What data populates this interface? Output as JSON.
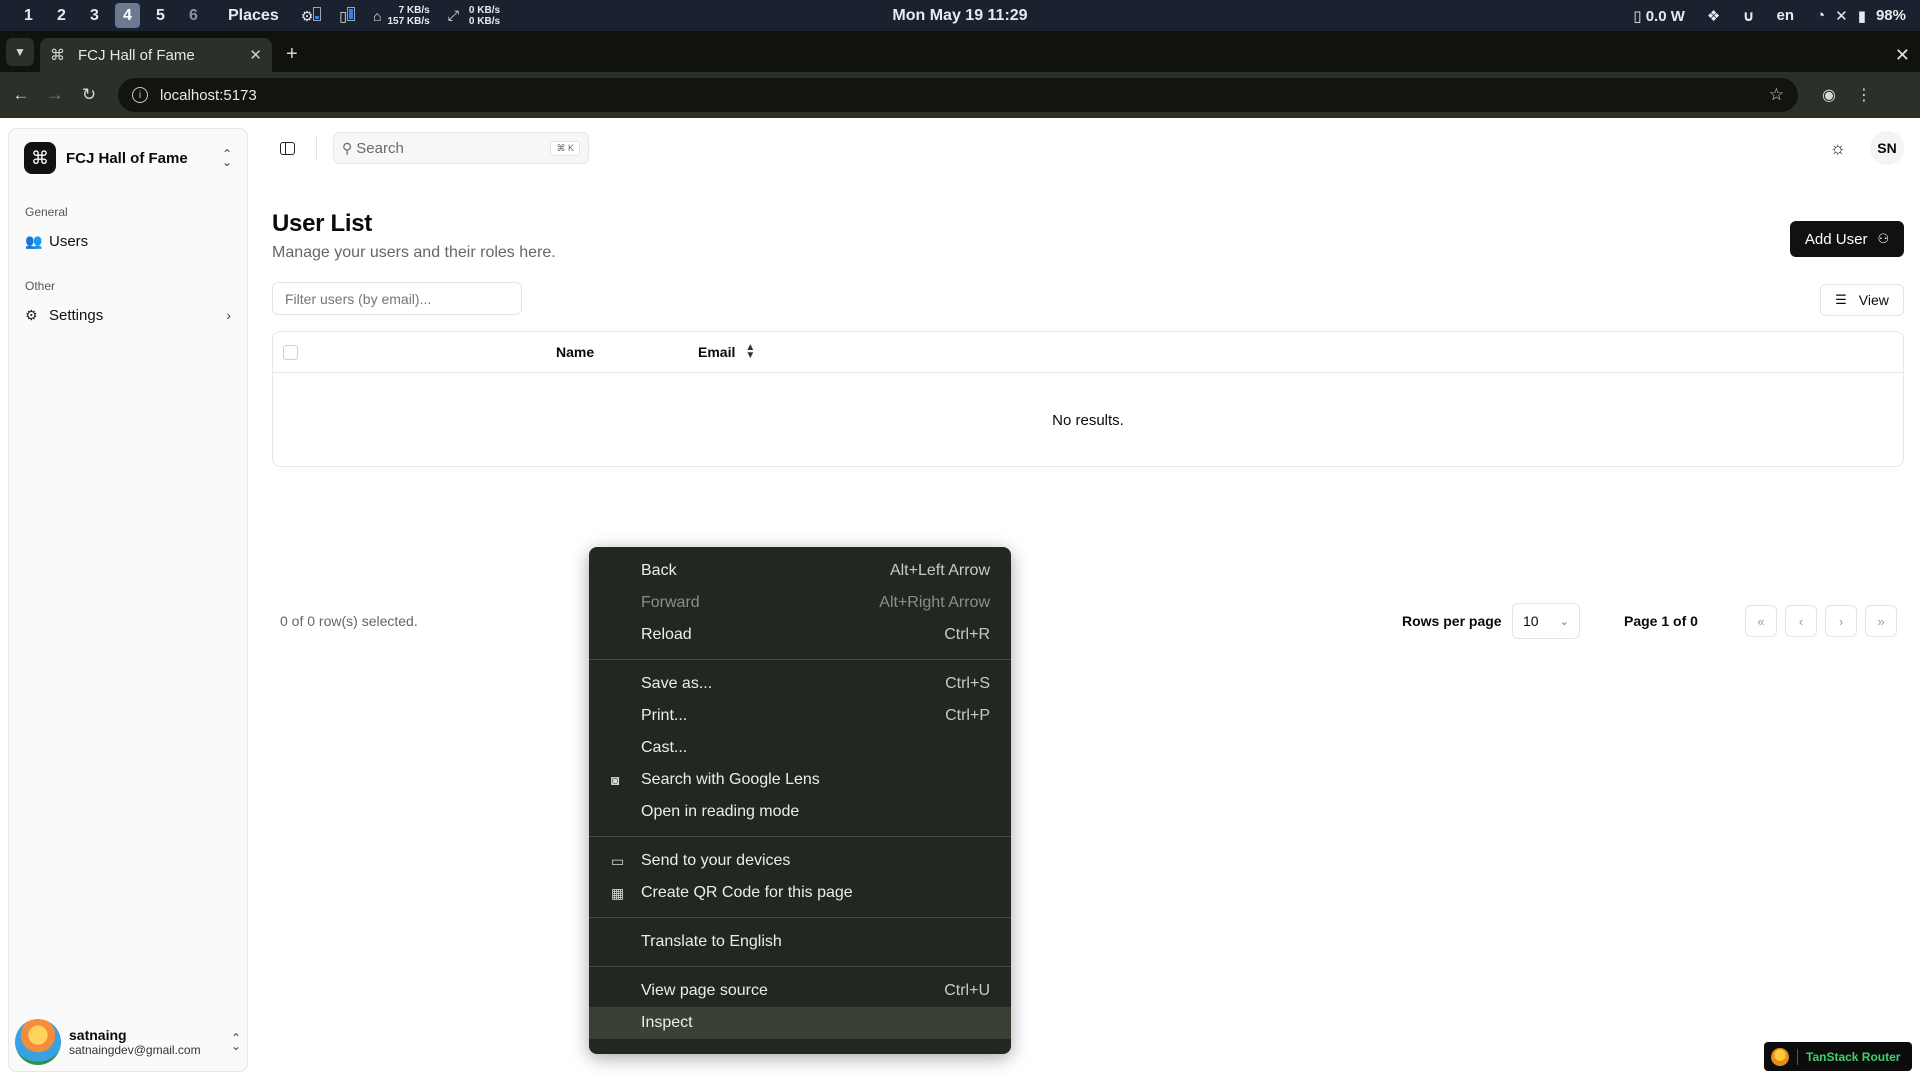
{
  "system": {
    "workspaces": [
      "1",
      "2",
      "3",
      "4",
      "5",
      "6"
    ],
    "active_workspace": "4",
    "places": "Places",
    "net_up": "7 KB/s",
    "net_down": "157 KB/s",
    "disk_up": "0 KB/s",
    "disk_down": "0 KB/s",
    "clock": "Mon May 19 11:29",
    "power": "0.0 W",
    "lang": "en",
    "battery": "98%"
  },
  "browser": {
    "tab_title": "FCJ Hall of Fame",
    "url": "localhost:5173"
  },
  "sidebar": {
    "team_name": "FCJ Hall of Fame",
    "groups": [
      {
        "label": "General",
        "items": [
          {
            "label": "Users"
          }
        ]
      },
      {
        "label": "Other",
        "items": [
          {
            "label": "Settings"
          }
        ]
      }
    ],
    "user": {
      "name": "satnaing",
      "email": "satnaingdev@gmail.com"
    }
  },
  "topbar": {
    "search_label": "Search",
    "search_kbd": "⌘ K",
    "initials": "SN"
  },
  "main": {
    "title": "User List",
    "subtitle": "Manage your users and their roles here.",
    "add_user_label": "Add User",
    "filter_placeholder": "Filter users (by email)...",
    "view_label": "View",
    "columns": [
      "Name",
      "Email"
    ],
    "empty_text": "No results.",
    "selected_text": "0 of 0 row(s) selected.",
    "rows_per_page_label": "Rows per page",
    "rows_per_page_value": "10",
    "page_text": "Page 1 of 0"
  },
  "context_menu": {
    "back": {
      "label": "Back",
      "shortcut": "Alt+Left Arrow"
    },
    "forward": {
      "label": "Forward",
      "shortcut": "Alt+Right Arrow"
    },
    "reload": {
      "label": "Reload",
      "shortcut": "Ctrl+R"
    },
    "save_as": {
      "label": "Save as...",
      "shortcut": "Ctrl+S"
    },
    "print": {
      "label": "Print...",
      "shortcut": "Ctrl+P"
    },
    "cast": {
      "label": "Cast..."
    },
    "lens": {
      "label": "Search with Google Lens"
    },
    "reading_mode": {
      "label": "Open in reading mode"
    },
    "send_devices": {
      "label": "Send to your devices"
    },
    "qr_code": {
      "label": "Create QR Code for this page"
    },
    "translate": {
      "label": "Translate to English"
    },
    "view_source": {
      "label": "View page source",
      "shortcut": "Ctrl+U"
    },
    "inspect": {
      "label": "Inspect"
    }
  },
  "devtools_badge": "TanStack Router"
}
